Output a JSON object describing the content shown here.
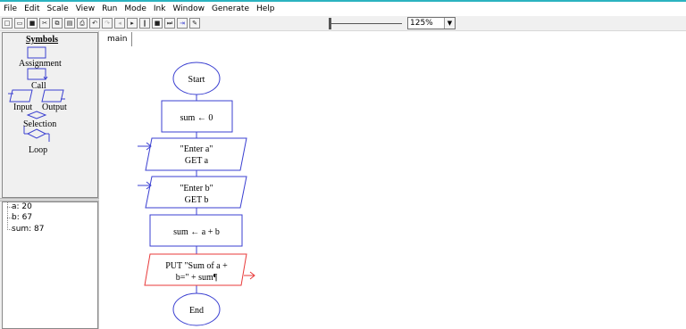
{
  "menu": [
    "File",
    "Edit",
    "Scale",
    "View",
    "Run",
    "Mode",
    "Ink",
    "Window",
    "Generate",
    "Help"
  ],
  "toolbar": {
    "zoom_value": "125%"
  },
  "symbols": {
    "title": "Symbols",
    "assignment": "Assignment",
    "call": "Call",
    "input": "Input",
    "output": "Output",
    "selection": "Selection",
    "loop": "Loop"
  },
  "variables": [
    {
      "text": "a: 20"
    },
    {
      "text": "b: 67"
    },
    {
      "text": "sum: 87"
    }
  ],
  "tab": {
    "label": "main"
  },
  "flowchart": {
    "start": "Start",
    "assign1": "sum ← 0",
    "input1_line1": "\"Enter a\"",
    "input1_line2": "GET a",
    "input2_line1": "\"Enter b\"",
    "input2_line2": "GET b",
    "assign2": "sum ← a  +  b",
    "output_line1": "PUT  \"Sum of a  +",
    "output_line2": "b=\"  +  sum¶",
    "end": "End"
  },
  "colors": {
    "flow_blue": "#3a3fd1",
    "flow_red": "#e83a3a",
    "accent_line": "#2bb3c0"
  }
}
